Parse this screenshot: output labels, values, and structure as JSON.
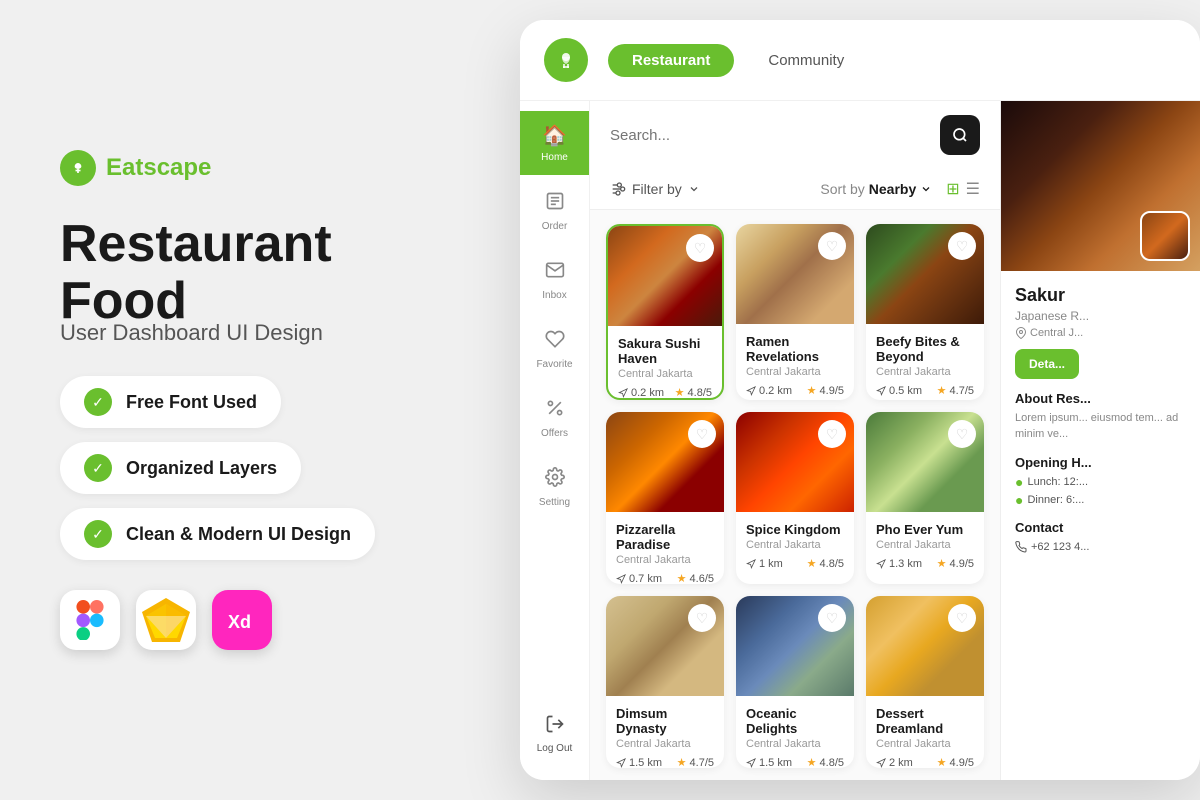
{
  "brand": {
    "name": "Eatscape",
    "icon": "🍽"
  },
  "left_panel": {
    "title_line1": "Restaurant Food",
    "subtitle": "User Dashboard UI Design",
    "features": [
      {
        "label": "Free Font Used"
      },
      {
        "label": "Organized Layers"
      },
      {
        "label": "Clean & Modern UI Design"
      }
    ]
  },
  "app": {
    "nav": {
      "logo_icon": "🍽",
      "tabs": [
        {
          "label": "Restaurant",
          "active": true
        },
        {
          "label": "Community",
          "active": false
        }
      ]
    },
    "search": {
      "placeholder": "Search...",
      "button_icon": "🔍"
    },
    "filter": {
      "label": "Filter by",
      "sort_label": "Sort by",
      "sort_value": "Nearby"
    },
    "sidebar": {
      "items": [
        {
          "label": "Home",
          "icon": "🏠",
          "active": true
        },
        {
          "label": "Order",
          "icon": "📋",
          "active": false
        },
        {
          "label": "Inbox",
          "icon": "💬",
          "active": false
        },
        {
          "label": "Favorite",
          "icon": "♡",
          "active": false
        },
        {
          "label": "Offers",
          "icon": "％",
          "active": false
        },
        {
          "label": "Setting",
          "icon": "⚙",
          "active": false
        }
      ],
      "logout": {
        "label": "Log Out",
        "icon": "↪"
      }
    },
    "restaurants": [
      {
        "name": "Sakura Sushi Haven",
        "location": "Central Jakarta",
        "distance": "0.2 km",
        "rating": "4.8/5",
        "food_class": "food-sushi",
        "highlighted": true
      },
      {
        "name": "Ramen Revelations",
        "location": "Central Jakarta",
        "distance": "0.2 km",
        "rating": "4.9/5",
        "food_class": "food-ramen",
        "highlighted": false
      },
      {
        "name": "Beefy Bites & Beyond",
        "location": "Central Jakarta",
        "distance": "0.5 km",
        "rating": "4.7/5",
        "food_class": "food-beef",
        "highlighted": false
      },
      {
        "name": "Pizzarella Paradise",
        "location": "Central Jakarta",
        "distance": "0.7 km",
        "rating": "4.6/5",
        "food_class": "food-pizza",
        "highlighted": false
      },
      {
        "name": "Spice Kingdom",
        "location": "Central Jakarta",
        "distance": "1 km",
        "rating": "4.8/5",
        "food_class": "food-spice",
        "highlighted": false
      },
      {
        "name": "Pho Ever Yum",
        "location": "Central Jakarta",
        "distance": "1.3 km",
        "rating": "4.9/5",
        "food_class": "food-pho",
        "highlighted": false
      },
      {
        "name": "Dimsum Dynasty",
        "location": "Central Jakarta",
        "distance": "1.5 km",
        "rating": "4.7/5",
        "food_class": "food-dimsum",
        "highlighted": false
      },
      {
        "name": "Oceanic Delights",
        "location": "Central Jakarta",
        "distance": "1.5 km",
        "rating": "4.8/5",
        "food_class": "food-oceanic",
        "highlighted": false
      },
      {
        "name": "Dessert Dreamland",
        "location": "Central Jakarta",
        "distance": "2 km",
        "rating": "4.9/5",
        "food_class": "food-dessert",
        "highlighted": false
      }
    ],
    "detail": {
      "title": "Sakur",
      "subtitle": "Japanese R...",
      "location": "Central J...",
      "button_label": "Deta...",
      "about_title": "About Res...",
      "about_text": "Lorem ipsum...\neiusmod tem...\nad minim ve...",
      "hours_title": "Opening H...",
      "lunch": "Lunch: 12:...",
      "dinner": "Dinner: 6:...",
      "contact_title": "Contact",
      "phone": "+62 123 4..."
    }
  },
  "colors": {
    "green": "#6abf2e",
    "dark": "#1a1a1a",
    "light_bg": "#f0f0f0"
  }
}
